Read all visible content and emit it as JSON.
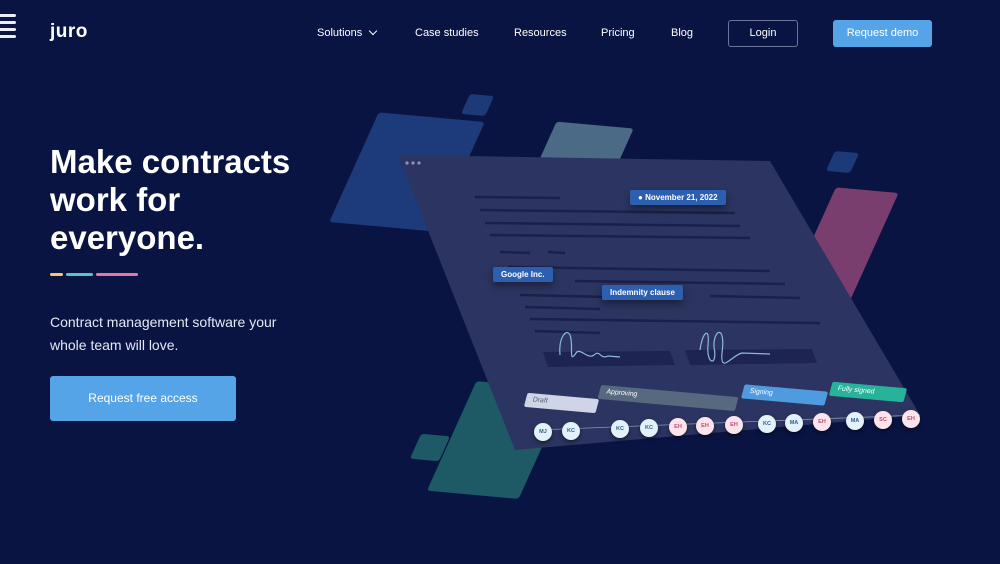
{
  "brand": {
    "logo": "juro"
  },
  "nav": {
    "items": [
      {
        "label": "Solutions",
        "dropdown": true
      },
      {
        "label": "Case studies"
      },
      {
        "label": "Resources"
      },
      {
        "label": "Pricing"
      },
      {
        "label": "Blog"
      }
    ],
    "login_label": "Login",
    "demo_label": "Request demo"
  },
  "hero": {
    "title_lines": [
      "Make contracts",
      "work for",
      "everyone."
    ],
    "subtitle_lines": [
      "Contract management software your",
      "whole team will love."
    ],
    "cta_label": "Request free access",
    "accent_colors": [
      "#f2c96b",
      "#5ec2c2",
      "#e27aa0"
    ]
  },
  "illustration": {
    "date_tag": "November 21, 2022",
    "party_tag": "Google Inc.",
    "clause_tag": "Indemnity clause",
    "stages": [
      {
        "label": "Draft",
        "color": "#cfd5e6"
      },
      {
        "label": "Approving",
        "color": "#56697f"
      },
      {
        "label": "Signing",
        "color": "#4f9be0"
      },
      {
        "label": "Fully signed",
        "color": "#27b39a"
      }
    ],
    "avatars": [
      "MJ",
      "KC",
      "KC",
      "KC",
      "EH",
      "EH",
      "EH",
      "KC",
      "MA",
      "EH",
      "MA",
      "SC",
      "EH"
    ]
  },
  "colors": {
    "background": "#0a1442",
    "accent": "#56a4e8",
    "document": "#2c3561"
  }
}
